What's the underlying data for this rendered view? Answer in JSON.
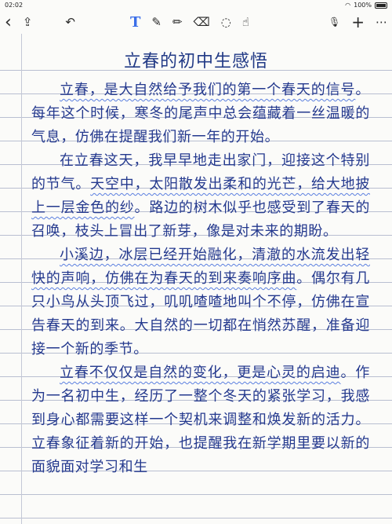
{
  "status": {
    "time": "02:02",
    "battery": "100%"
  },
  "toolbar": {
    "back_icon": "‹",
    "share_icon": "⇪",
    "undo_icon": "↶",
    "text_tool_icon": "T",
    "pen_icon": "✎",
    "pencil_icon": "✏",
    "eraser_icon": "⌫",
    "lasso_icon": "◌",
    "hand_icon": "☝",
    "mic_icon": "🎙",
    "add_icon": "+",
    "more_icon": "⋯"
  },
  "note": {
    "title": "立春的初中生感悟",
    "paragraphs": [
      [
        {
          "t": "立春，是大自然给予我们的第一个春天的信号",
          "hl": true
        },
        {
          "t": "。每年这个时候，寒冬的尾声中总会蕴藏着一丝温暖的气息，仿佛在提醒我们新一年的开始。",
          "hl": false
        }
      ],
      [
        {
          "t": "在立春这天，我早早地走出家门，迎接这个特别的节气。",
          "hl": false
        },
        {
          "t": "天空中，太阳散发出柔和的光芒，给大地披上一层金色的纱",
          "hl": true
        },
        {
          "t": "。路边的树木似乎也感受到了春天的召唤，枝头上冒出了新芽，像是对未来的期盼。",
          "hl": false
        }
      ],
      [
        {
          "t": "小溪边，冰层已经开始融化，清澈的水流发出轻快的声响，仿佛在为春天的到来奏响序曲",
          "hl": true
        },
        {
          "t": "。偶尔有几只小鸟从头顶飞过，叽叽喳喳地叫个不停，仿佛在宣告春天的到来。大自然的一切都在悄然苏醒，准备迎接一个新的季节。",
          "hl": false
        }
      ],
      [
        {
          "t": "立春不仅仅是自然的变化，更是心灵的启迪",
          "hl": true
        },
        {
          "t": "。作为一名初中生，经历了一整个冬天的紧张学习，我感到身心都需要这样一个契机来调整和焕发新的活力。立春象征着新的开始，也提醒我在新学期里要以新的面貌面对学习和生",
          "hl": false
        }
      ]
    ]
  }
}
